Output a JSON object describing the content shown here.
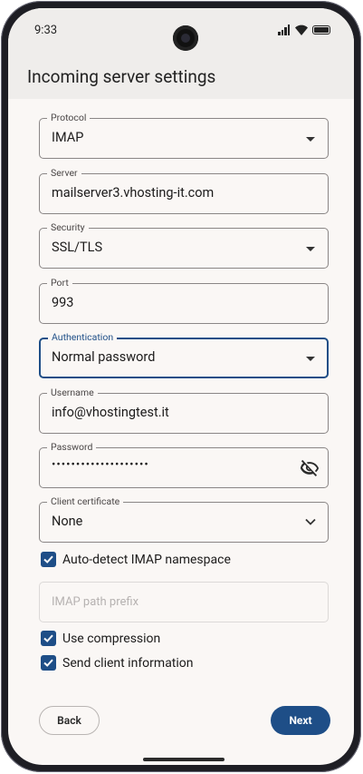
{
  "status_bar": {
    "time": "9:33"
  },
  "header": {
    "title": "Incoming server settings"
  },
  "form": {
    "protocol": {
      "label": "Protocol",
      "value": "IMAP"
    },
    "server": {
      "label": "Server",
      "value": "mailserver3.vhosting-it.com"
    },
    "security": {
      "label": "Security",
      "value": "SSL/TLS"
    },
    "port": {
      "label": "Port",
      "value": "993"
    },
    "authentication": {
      "label": "Authentication",
      "value": "Normal password"
    },
    "username": {
      "label": "Username",
      "value": "info@vhostingtest.it"
    },
    "password": {
      "label": "Password",
      "value": "••••••••••••••••••••"
    },
    "client_certificate": {
      "label": "Client certificate",
      "value": "None"
    },
    "auto_detect_namespace": {
      "label": "Auto-detect IMAP namespace",
      "checked": true
    },
    "imap_path_prefix": {
      "placeholder": "IMAP path prefix"
    },
    "use_compression": {
      "label": "Use compression",
      "checked": true
    },
    "send_client_info": {
      "label": "Send client information",
      "checked": true
    }
  },
  "actions": {
    "back": "Back",
    "next": "Next"
  },
  "colors": {
    "accent": "#1e4e87",
    "background": "#faf7f5",
    "appbar": "#efedeb"
  }
}
